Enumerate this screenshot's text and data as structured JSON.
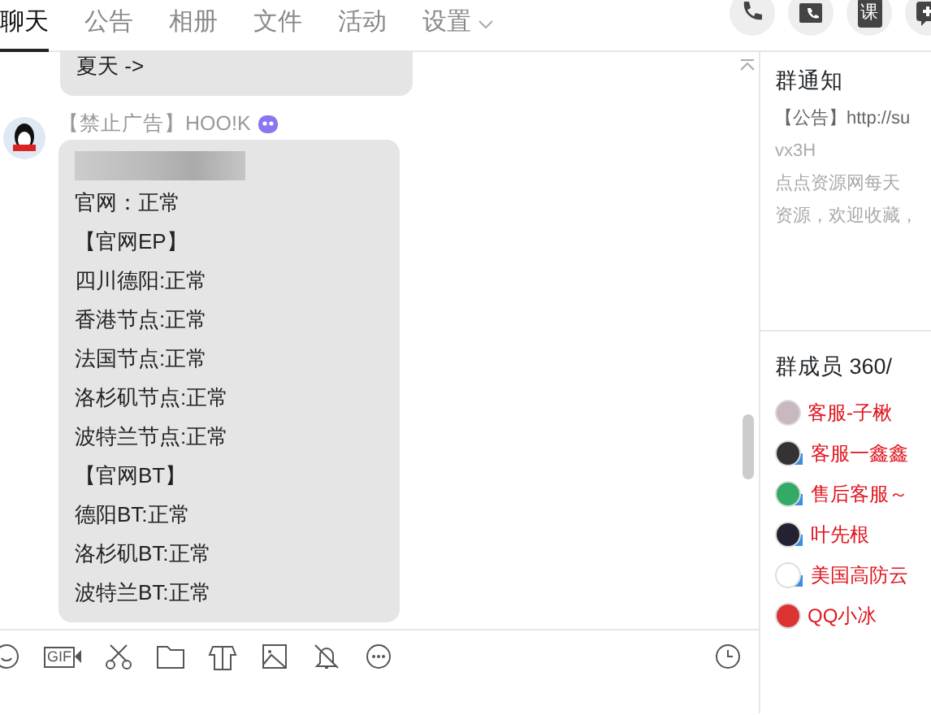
{
  "tabs": [
    {
      "label": "聊天",
      "selected": true,
      "dropdown": false
    },
    {
      "label": "公告",
      "selected": false,
      "dropdown": false
    },
    {
      "label": "相册",
      "selected": false,
      "dropdown": false
    },
    {
      "label": "文件",
      "selected": false,
      "dropdown": false
    },
    {
      "label": "活动",
      "selected": false,
      "dropdown": false
    },
    {
      "label": "设置",
      "selected": false,
      "dropdown": true
    }
  ],
  "header_actions": [
    {
      "kind": "phone"
    },
    {
      "kind": "video"
    },
    {
      "kind": "text",
      "label": "课"
    },
    {
      "kind": "add"
    }
  ],
  "messages": [
    {
      "lines": [
        "夏天 ->"
      ],
      "blurred_line": false
    },
    {
      "sender": "【禁止广告】HOO!K",
      "lines": [
        "官网：正常",
        "【官网EP】",
        "四川德阳:正常",
        "香港节点:正常",
        "法国节点:正常",
        "洛杉矶节点:正常",
        "波特兰节点:正常",
        "【官网BT】",
        "德阳BT:正常",
        "洛杉矶BT:正常",
        "波特兰BT:正常"
      ],
      "blurred_line": true
    }
  ],
  "toolbar": [
    {
      "kind": "emoji"
    },
    {
      "kind": "gif",
      "label": "GIF"
    },
    {
      "kind": "scissors"
    },
    {
      "kind": "folder"
    },
    {
      "kind": "shirt"
    },
    {
      "kind": "image"
    },
    {
      "kind": "bell-off"
    },
    {
      "kind": "more"
    }
  ],
  "group_notice": {
    "title": "群通知",
    "lines": [
      "【公告】http://su",
      "vx3H",
      "点点资源网每天",
      "资源，欢迎收藏，"
    ]
  },
  "members": {
    "title": "群成员 360/",
    "items": [
      {
        "name": "客服-子楸",
        "badge": false
      },
      {
        "name": "客服一鑫鑫",
        "badge": true
      },
      {
        "name": "售后客服～",
        "badge": true
      },
      {
        "name": "叶先根",
        "badge": true
      },
      {
        "name": "美国高防云",
        "badge": true
      },
      {
        "name": "QQ小冰",
        "badge": false
      }
    ]
  }
}
